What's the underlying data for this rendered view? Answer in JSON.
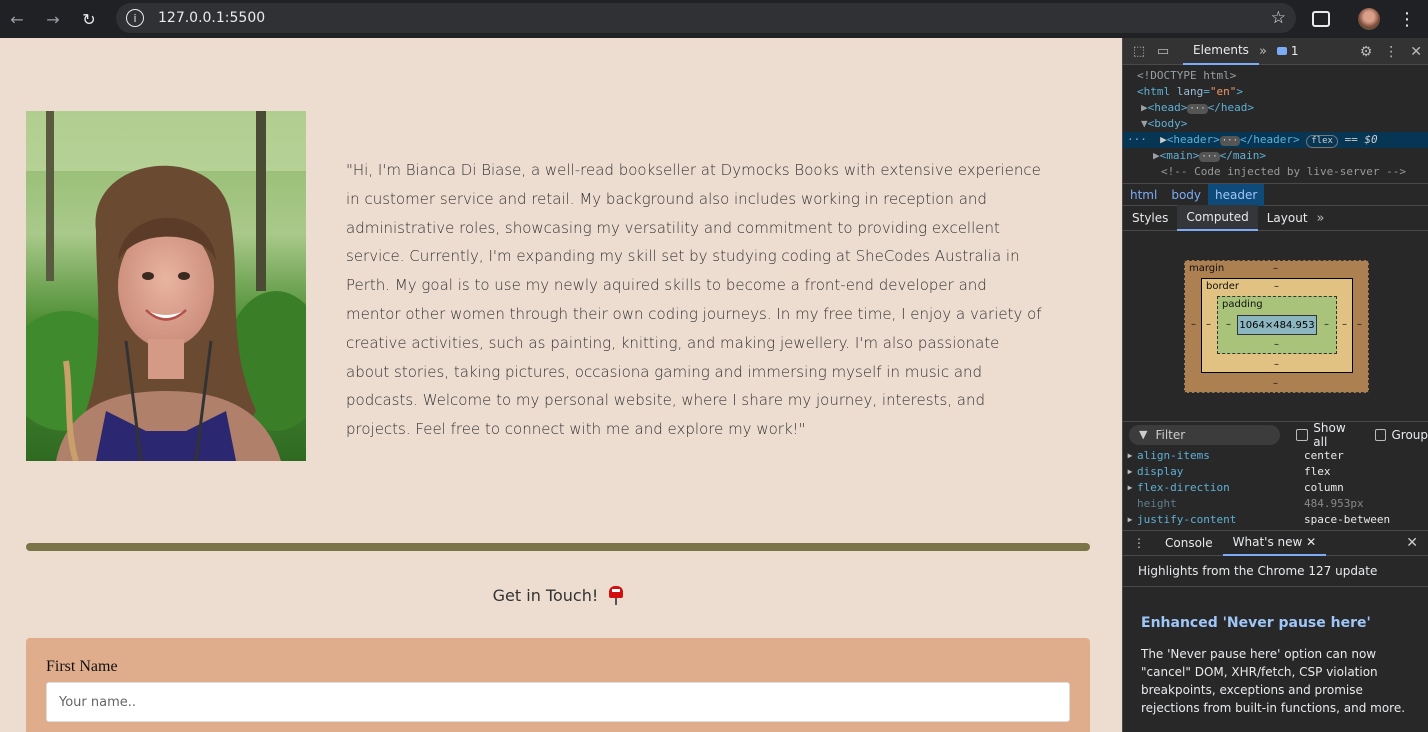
{
  "browser": {
    "url": "127.0.0.1:5500"
  },
  "page": {
    "bio": "\"Hi, I'm Bianca Di Biase, a well-read bookseller at Dymocks Books with extensive experience in customer service and retail. My background also includes working in reception and administrative roles, showcasing my versatility and commitment to providing excellent service. Currently, I'm expanding my skill set by studying coding at SheCodes Australia in Perth. My goal is to use my newly aquired skills to become a front-end developer and mentor other women through their own coding journeys. In my free time, I enjoy a variety of creative activities, such as painting, knitting, and making jewellery. I'm also passionate about stories, taking pictures, occasiona gaming and immersing myself in music and podcasts. Welcome to my personal website, where I share my journey, interests, and projects. Feel free to connect with me and explore my work!\"",
    "contact_title": "Get in Touch!",
    "form": {
      "first_name_label": "First Name",
      "first_name_placeholder": "Your name.."
    },
    "colors": {
      "background": "#eddcd0",
      "divider": "#7a7448",
      "form_card": "#e0ad8c"
    }
  },
  "devtools": {
    "tabs": {
      "elements": "Elements",
      "issues_count": "1"
    },
    "dom": {
      "doctype": "<!DOCTYPE html>",
      "html_open": "<html",
      "lang_attr": "lang",
      "lang_val": "\"en\"",
      "html_close": ">",
      "head": "<head>",
      "head_close": "</head>",
      "body": "<body>",
      "header": "<header>",
      "header_close": "</header>",
      "flex_badge": "flex",
      "sel_marker": "== $0",
      "main": "<main>",
      "main_close": "</main>",
      "comment": "<!-- Code injected by live-server -->",
      "ellipsis": "···",
      "dots": "···"
    },
    "breadcrumbs": [
      "html",
      "body",
      "header"
    ],
    "subtabs": {
      "styles": "Styles",
      "computed": "Computed",
      "layout": "Layout"
    },
    "box_model": {
      "margin_label": "margin",
      "border_label": "border",
      "padding_label": "padding",
      "content": "1064×484.953",
      "dash": "–"
    },
    "filter": {
      "placeholder": "Filter",
      "show_all": "Show all",
      "group": "Group"
    },
    "computed": [
      {
        "name": "align-items",
        "value": "center"
      },
      {
        "name": "display",
        "value": "flex"
      },
      {
        "name": "flex-direction",
        "value": "column"
      },
      {
        "name": "height",
        "value": "484.953px"
      },
      {
        "name": "justify-content",
        "value": "space-between"
      }
    ],
    "drawer": {
      "console": "Console",
      "whats_new": "What's new",
      "highlights": "Highlights from the Chrome 127 update",
      "feature_title": "Enhanced 'Never pause here'",
      "feature_desc": "The 'Never pause here' option can now \"cancel\" DOM, XHR/fetch, CSP violation breakpoints, exceptions and promise rejections from built-in functions, and more."
    }
  }
}
